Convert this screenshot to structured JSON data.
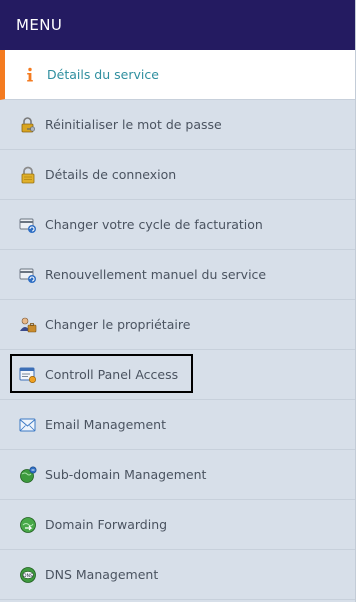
{
  "menu": {
    "title": "MENU",
    "items": [
      {
        "label": "Détails du service",
        "icon": "info-icon",
        "active": true
      },
      {
        "label": "Réinitialiser le mot de passe",
        "icon": "key-lock-icon"
      },
      {
        "label": "Détails de connexion",
        "icon": "padlock-icon"
      },
      {
        "label": "Changer votre cycle de facturation",
        "icon": "billing-cycle-icon"
      },
      {
        "label": "Renouvellement manuel du service",
        "icon": "renewal-icon"
      },
      {
        "label": "Changer le propriétaire",
        "icon": "owner-change-icon"
      },
      {
        "label": "Controll Panel Access",
        "icon": "control-panel-icon",
        "focused": true
      },
      {
        "label": "Email Management",
        "icon": "email-icon"
      },
      {
        "label": "Sub-domain Management",
        "icon": "subdomain-globe-icon"
      },
      {
        "label": "Domain Forwarding",
        "icon": "domain-forwarding-icon"
      },
      {
        "label": "DNS Management",
        "icon": "dns-icon"
      }
    ]
  },
  "colors": {
    "header_bg": "#241b61",
    "menu_bg": "#d7dfe9",
    "active_accent": "#f47b20",
    "active_text": "#2f8f9f"
  }
}
